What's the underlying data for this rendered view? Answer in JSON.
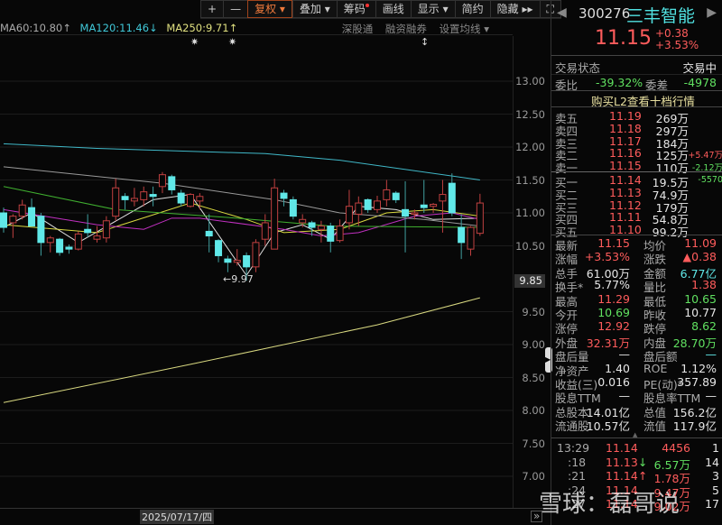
{
  "toolbar": {
    "plus": "+",
    "minus": "—",
    "fuquan": "复权 ▾",
    "diejia": "叠加 ▾",
    "chouma": "筹码",
    "huaxian": "画线",
    "xianshi": "显示 ▾",
    "jianyue": "简约",
    "yincang": "隐藏 ▸▸",
    "fullscreen": "⛶"
  },
  "ma_legend": {
    "ma60": "MA60:10.80↑",
    "ma120": "MA120:11.46↓",
    "ma250": "MA250:9.71↑"
  },
  "chart_options": [
    "深股通",
    "融资融券",
    "设置均线 ▾"
  ],
  "markers": [
    "✷",
    "✷",
    "↕"
  ],
  "y_axis": [
    "13.00",
    "12.50",
    "12.00",
    "11.50",
    "11.00",
    "10.50",
    "9.50",
    "9.00",
    "8.50",
    "8.00",
    "7.50",
    "7.00"
  ],
  "current_price_tag": "9.85",
  "low_annotation": "←9.97",
  "date_label": "2025/07/17/四",
  "scroll_right": "»",
  "colors": {
    "up": "#ff5c5c",
    "down": "#60e8e8",
    "ma5": "#e0e0e0",
    "ma10": "#d8d840",
    "ma20": "#c030c0",
    "ma30": "#40b030",
    "ma60": "#aaaaaa",
    "ma120": "#40b8c8",
    "ma250": "#d8d880"
  },
  "chart_data": {
    "type": "candlestick",
    "ylim": [
      6.75,
      13.5
    ],
    "candles": [
      [
        11.0,
        11.08,
        10.7,
        10.78
      ],
      [
        10.85,
        10.98,
        10.62,
        10.95
      ],
      [
        10.95,
        11.2,
        10.9,
        11.12
      ],
      [
        11.08,
        11.22,
        10.95,
        10.8
      ],
      [
        10.95,
        11.0,
        10.35,
        10.55
      ],
      [
        10.55,
        10.65,
        10.4,
        10.62
      ],
      [
        10.6,
        10.62,
        10.35,
        10.4
      ],
      [
        10.48,
        10.52,
        10.38,
        10.45
      ],
      [
        10.45,
        10.72,
        10.43,
        10.68
      ],
      [
        10.75,
        10.98,
        10.63,
        10.7
      ],
      [
        10.6,
        10.8,
        10.55,
        10.65
      ],
      [
        10.62,
        10.95,
        10.55,
        10.88
      ],
      [
        10.95,
        11.52,
        10.88,
        11.38
      ],
      [
        11.25,
        11.3,
        11.05,
        11.2
      ],
      [
        11.18,
        11.38,
        11.1,
        11.22
      ],
      [
        11.2,
        11.4,
        11.1,
        11.32
      ],
      [
        11.28,
        11.4,
        11.1,
        11.25
      ],
      [
        11.4,
        11.62,
        11.3,
        11.58
      ],
      [
        11.55,
        11.58,
        11.28,
        11.35
      ],
      [
        11.3,
        11.35,
        11.1,
        11.15
      ],
      [
        11.1,
        11.3,
        11.08,
        11.28
      ],
      [
        11.18,
        11.3,
        11.05,
        11.25
      ],
      [
        10.72,
        10.98,
        10.4,
        10.65
      ],
      [
        10.58,
        10.6,
        10.25,
        10.35
      ],
      [
        10.3,
        10.35,
        10.1,
        10.25
      ],
      [
        10.25,
        10.45,
        10.2,
        10.28
      ],
      [
        10.35,
        10.4,
        9.97,
        10.18
      ],
      [
        10.18,
        10.6,
        10.1,
        10.55
      ],
      [
        10.6,
        10.98,
        10.5,
        10.85
      ],
      [
        10.45,
        11.52,
        10.45,
        11.38
      ],
      [
        11.3,
        11.35,
        11.1,
        11.22
      ],
      [
        11.2,
        11.25,
        10.9,
        10.95
      ],
      [
        10.85,
        10.98,
        10.78,
        10.9
      ],
      [
        10.85,
        10.88,
        10.65,
        10.78
      ],
      [
        10.75,
        10.88,
        10.55,
        10.8
      ],
      [
        10.8,
        10.85,
        10.4,
        10.57
      ],
      [
        10.58,
        10.9,
        10.55,
        10.8
      ],
      [
        10.85,
        11.35,
        10.75,
        11.1
      ],
      [
        10.98,
        11.25,
        10.8,
        11.15
      ],
      [
        11.2,
        11.22,
        11.0,
        11.05
      ],
      [
        11.05,
        11.26,
        11.0,
        11.18
      ],
      [
        11.2,
        11.5,
        11.1,
        11.35
      ],
      [
        11.3,
        11.33,
        11.15,
        11.2
      ],
      [
        11.05,
        11.48,
        10.4,
        10.95
      ],
      [
        10.98,
        11.05,
        10.9,
        11.0
      ],
      [
        11.12,
        11.5,
        11.0,
        11.08
      ],
      [
        11.1,
        11.15,
        11.0,
        11.13
      ],
      [
        11.18,
        11.5,
        10.7,
        11.28
      ],
      [
        11.45,
        11.6,
        10.95,
        11.0
      ],
      [
        10.78,
        10.98,
        10.3,
        10.55
      ],
      [
        10.45,
        10.8,
        10.35,
        10.78
      ],
      [
        10.69,
        11.29,
        10.65,
        11.15
      ]
    ],
    "ma": [
      {
        "name": "MA5",
        "color": "#e0e0e0",
        "points": [
          [
            0,
            10.78
          ],
          [
            3,
            11.0
          ],
          [
            8,
            10.55
          ],
          [
            16,
            11.2
          ],
          [
            20,
            11.28
          ],
          [
            26,
            10.05
          ],
          [
            29,
            10.7
          ],
          [
            32,
            10.82
          ],
          [
            35,
            10.6
          ],
          [
            38,
            11.1
          ],
          [
            42,
            11.05
          ],
          [
            46,
            10.9
          ],
          [
            51,
            10.92
          ]
        ]
      },
      {
        "name": "MA10",
        "color": "#d8d840",
        "points": [
          [
            0,
            10.82
          ],
          [
            10,
            10.7
          ],
          [
            20,
            11.15
          ],
          [
            26,
            10.9
          ],
          [
            30,
            10.7
          ],
          [
            36,
            10.75
          ],
          [
            41,
            11.0
          ],
          [
            46,
            11.05
          ],
          [
            51,
            10.95
          ]
        ]
      },
      {
        "name": "MA20",
        "color": "#c030c0",
        "points": [
          [
            0,
            11.05
          ],
          [
            10,
            10.82
          ],
          [
            15,
            10.75
          ],
          [
            18,
            10.92
          ],
          [
            21,
            10.92
          ],
          [
            30,
            10.75
          ],
          [
            34,
            10.65
          ],
          [
            38,
            10.7
          ],
          [
            44,
            10.95
          ],
          [
            48,
            11.0
          ],
          [
            51,
            10.9
          ]
        ]
      },
      {
        "name": "MA30",
        "color": "#40b030",
        "points": [
          [
            0,
            11.4
          ],
          [
            12,
            11.05
          ],
          [
            25,
            10.92
          ],
          [
            35,
            10.8
          ],
          [
            51,
            10.78
          ]
        ]
      },
      {
        "name": "MA60",
        "color": "#999999",
        "points": [
          [
            0,
            11.7
          ],
          [
            17,
            11.45
          ],
          [
            29,
            11.2
          ],
          [
            36,
            11.0
          ],
          [
            45,
            10.9
          ],
          [
            51,
            10.8
          ]
        ]
      },
      {
        "name": "MA120",
        "color": "#40b8c8",
        "points": [
          [
            0,
            12.05
          ],
          [
            10,
            11.98
          ],
          [
            28,
            11.9
          ],
          [
            36,
            11.8
          ],
          [
            51,
            11.5
          ]
        ]
      },
      {
        "name": "MA250",
        "color": "#d8d880",
        "points": [
          [
            0,
            8.12
          ],
          [
            20,
            8.7
          ],
          [
            40,
            9.3
          ],
          [
            51,
            9.71
          ]
        ]
      }
    ]
  },
  "quote": {
    "code": "300276",
    "name": "三丰智能",
    "price": "11.15",
    "change": "+0.38",
    "change_pct": "+3.53%",
    "status_label": "交易状态",
    "status": "交易中",
    "weibi_label": "委比",
    "weibi": "-39.32%",
    "weicha_label": "委差",
    "weicha": "-4978",
    "l2_link": "购买L2查看十档行情",
    "asks": [
      {
        "label": "卖五",
        "price": "11.19",
        "vol": "269万",
        "chg": ""
      },
      {
        "label": "卖四",
        "price": "11.18",
        "vol": "297万",
        "chg": ""
      },
      {
        "label": "卖三",
        "price": "11.17",
        "vol": "184万",
        "chg": ""
      },
      {
        "label": "卖二",
        "price": "11.16",
        "vol": "125万",
        "chg": "+5.47万"
      },
      {
        "label": "卖一",
        "price": "11.15",
        "vol": "110万",
        "chg": "-2.12万"
      }
    ],
    "bids": [
      {
        "label": "买一",
        "price": "11.14",
        "vol": "19.5万",
        "chg": "-5570"
      },
      {
        "label": "买二",
        "price": "11.13",
        "vol": "74.9万",
        "chg": ""
      },
      {
        "label": "买三",
        "price": "11.12",
        "vol": "179万",
        "chg": ""
      },
      {
        "label": "买四",
        "price": "11.11",
        "vol": "54.8万",
        "chg": ""
      },
      {
        "label": "买五",
        "price": "11.10",
        "vol": "99.2万",
        "chg": ""
      }
    ],
    "stats": [
      [
        "最新",
        "11.15",
        "red",
        "均价",
        "11.09",
        "red"
      ],
      [
        "涨幅",
        "+3.53%",
        "red",
        "涨跌",
        "▲0.38",
        "red"
      ],
      [
        "总手",
        "61.00万",
        "wht",
        "金额",
        "6.77亿",
        "cyn"
      ],
      [
        "换手*",
        "5.77%",
        "wht",
        "量比",
        "1.38",
        "red"
      ],
      [
        "最高",
        "11.29",
        "red",
        "最低",
        "10.65",
        "grn"
      ],
      [
        "今开",
        "10.69",
        "grn",
        "昨收",
        "10.77",
        "wht"
      ],
      [
        "涨停",
        "12.92",
        "red",
        "跌停",
        "8.62",
        "grn"
      ],
      [
        "外盘",
        "32.31万",
        "red",
        "内盘",
        "28.70万",
        "grn"
      ],
      [
        "盘后量",
        "—",
        "wht",
        "盘后额",
        "—",
        "cyn"
      ],
      [
        "净资产",
        "1.40",
        "wht",
        "ROE",
        "1.12%",
        "wht"
      ],
      [
        "收益(三)",
        "0.016",
        "wht",
        "PE(动)*",
        "357.89",
        "wht"
      ],
      [
        "股息TTM",
        "—",
        "wht",
        "股息率TTM",
        "—",
        "wht"
      ],
      [
        "总股本",
        "14.01亿",
        "wht",
        "总值",
        "156.2亿",
        "wht"
      ],
      [
        "流通股",
        "10.57亿",
        "wht",
        "流值",
        "117.9亿",
        "wht"
      ]
    ],
    "ticks": [
      [
        "13:29",
        "11.14",
        "",
        "4456",
        "red",
        "1"
      ],
      [
        ":18",
        "11.13",
        "↓",
        "6.57万",
        "grn",
        "14"
      ],
      [
        ":21",
        "11.14",
        "↑",
        "1.78万",
        "red",
        "3"
      ],
      [
        ":24",
        "11.14",
        "",
        "9.47万",
        "red",
        "5"
      ],
      [
        ":27",
        "11.14",
        "",
        "9.02万",
        "red",
        "17"
      ]
    ]
  },
  "watermark": "雪球：磊哥说"
}
